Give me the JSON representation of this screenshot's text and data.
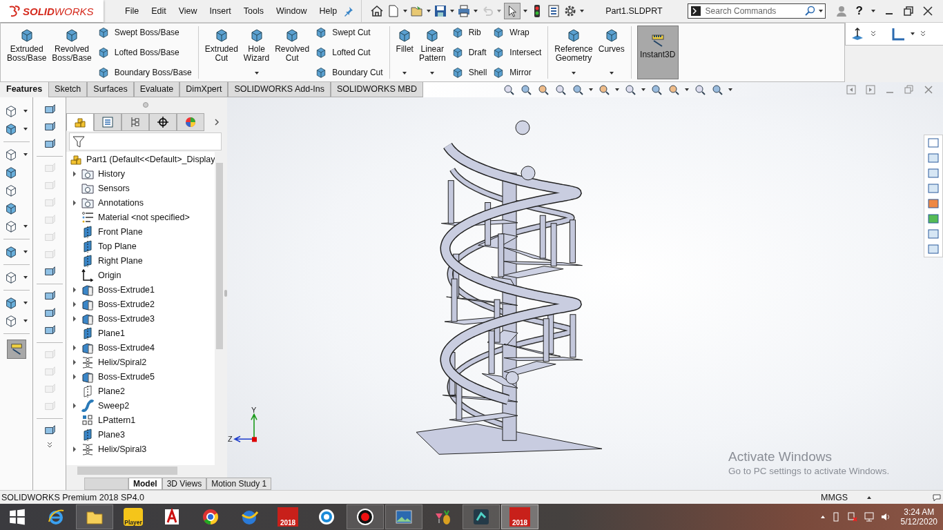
{
  "logo": "**SOLID**WORKS",
  "menu": [
    "File",
    "Edit",
    "View",
    "Insert",
    "Tools",
    "Window",
    "Help"
  ],
  "document_title": "Part1.SLDPRT",
  "search": {
    "placeholder": "Search Commands"
  },
  "help": {
    "label": "?"
  },
  "ribbon": [
    {
      "large": [
        {
          "label": "Extruded Boss/Base",
          "dropdown": false
        },
        {
          "label": "Revolved Boss/Base",
          "dropdown": false
        }
      ],
      "small": [
        [
          "Swept Boss/Base",
          "Lofted Boss/Base",
          "Boundary Boss/Base"
        ]
      ]
    },
    {
      "large": [
        {
          "label": "Extruded Cut",
          "dropdown": false
        },
        {
          "label": "Hole Wizard",
          "dropdown": true
        },
        {
          "label": "Revolved Cut",
          "dropdown": false
        }
      ],
      "small": [
        [
          "Swept Cut",
          "Lofted Cut",
          "Boundary Cut"
        ]
      ]
    },
    {
      "large": [
        {
          "label": "Fillet",
          "dropdown": true
        },
        {
          "label": "Linear Pattern",
          "dropdown": true
        }
      ],
      "small": [
        [
          "Rib",
          "Draft",
          "Shell"
        ],
        [
          "Wrap",
          "Intersect",
          "Mirror"
        ]
      ]
    },
    {
      "large": [
        {
          "label": "Reference Geometry",
          "dropdown": true
        },
        {
          "label": "Curves",
          "dropdown": true
        }
      ]
    }
  ],
  "instant3d": {
    "label": "Instant3D",
    "on": true
  },
  "tabs": [
    {
      "label": "Features",
      "selected": true
    },
    {
      "label": "Sketch",
      "selected": false
    },
    {
      "label": "Surfaces",
      "selected": false
    },
    {
      "label": "Evaluate",
      "selected": false
    },
    {
      "label": "DimXpert",
      "selected": false
    },
    {
      "label": "SOLIDWORKS Add-Ins",
      "selected": false
    },
    {
      "label": "SOLIDWORKS MBD",
      "selected": false
    }
  ],
  "side_toolbar": [
    {
      "disabled": false
    },
    {
      "disabled": false
    },
    {
      "disabled": false
    },
    {
      "disabled": true
    },
    {
      "disabled": true
    },
    {
      "disabled": true
    },
    {
      "disabled": true
    },
    {
      "disabled": true
    },
    {
      "disabled": true
    },
    {
      "disabled": false
    },
    {
      "disabled": false
    },
    {
      "disabled": false
    },
    {
      "disabled": false
    },
    {
      "disabled": true
    },
    {
      "disabled": true
    },
    {
      "disabled": true
    },
    {
      "disabled": true
    },
    {
      "disabled": false
    }
  ],
  "manager_tabs": [
    {
      "selected": true
    },
    {
      "selected": false
    },
    {
      "selected": false
    },
    {
      "selected": false
    },
    {
      "selected": false
    }
  ],
  "tree": {
    "root": {
      "label": "Part1  (Default<<Default>_Display",
      "kind": "part"
    },
    "items": [
      {
        "label": "History",
        "kind": "folder",
        "expandable": true
      },
      {
        "label": "Sensors",
        "kind": "folder",
        "expandable": false
      },
      {
        "label": "Annotations",
        "kind": "folder",
        "expandable": true
      },
      {
        "label": "Material <not specified>",
        "kind": "material",
        "expandable": false
      },
      {
        "label": "Front Plane",
        "kind": "plane",
        "expandable": false
      },
      {
        "label": "Top Plane",
        "kind": "plane",
        "expandable": false
      },
      {
        "label": "Right Plane",
        "kind": "plane",
        "expandable": false
      },
      {
        "label": "Origin",
        "kind": "origin",
        "expandable": false
      },
      {
        "label": "Boss-Extrude1",
        "kind": "extrude",
        "expandable": true
      },
      {
        "label": "Boss-Extrude2",
        "kind": "extrude",
        "expandable": true
      },
      {
        "label": "Boss-Extrude3",
        "kind": "extrude",
        "expandable": true
      },
      {
        "label": "Plane1",
        "kind": "plane",
        "expandable": false
      },
      {
        "label": "Boss-Extrude4",
        "kind": "extrude",
        "expandable": true
      },
      {
        "label": "Helix/Spiral2",
        "kind": "helix",
        "expandable": true
      },
      {
        "label": "Boss-Extrude5",
        "kind": "extrude",
        "expandable": true
      },
      {
        "label": "Plane2",
        "kind": "hiddenplane",
        "expandable": false
      },
      {
        "label": "Sweep2",
        "kind": "sweep",
        "expandable": true
      },
      {
        "label": "LPattern1",
        "kind": "pattern",
        "expandable": false
      },
      {
        "label": "Plane3",
        "kind": "plane",
        "expandable": false
      },
      {
        "label": "Helix/Spiral3",
        "kind": "helix",
        "expandable": true
      }
    ]
  },
  "bottom_tabs": [
    {
      "label": "Model",
      "selected": true
    },
    {
      "label": "3D Views",
      "selected": false
    },
    {
      "label": "Motion Study 1",
      "selected": false
    }
  ],
  "triad": {
    "y": "Y",
    "z": "Z"
  },
  "activation": {
    "title": "Activate Windows",
    "text": "Go to PC settings to activate Windows."
  },
  "status_bar": {
    "product": "SOLIDWORKS Premium 2018 SP4.0",
    "units": "MMGS"
  },
  "taskbar": [
    {
      "kind": "ie",
      "running": false,
      "selected": false
    },
    {
      "kind": "explorer",
      "running": true,
      "selected": false
    },
    {
      "kind": "player",
      "label": "Player",
      "running": false,
      "selected": false
    },
    {
      "kind": "autocad",
      "running": false,
      "selected": false
    },
    {
      "kind": "chrome",
      "running": false,
      "selected": false
    },
    {
      "kind": "globe",
      "running": false,
      "selected": false
    },
    {
      "kind": "sw",
      "label": "2018",
      "running": false,
      "selected": false
    },
    {
      "kind": "aperture",
      "running": false,
      "selected": false
    },
    {
      "kind": "record",
      "running": true,
      "selected": false
    },
    {
      "kind": "photos",
      "running": true,
      "selected": false
    },
    {
      "kind": "drink",
      "running": false,
      "selected": false
    },
    {
      "kind": "filmora",
      "running": true,
      "selected": false
    },
    {
      "kind": "sw",
      "label": "2018",
      "running": true,
      "selected": true
    }
  ],
  "clock": {
    "time": "3:24 AM",
    "date": "5/12/2020"
  }
}
